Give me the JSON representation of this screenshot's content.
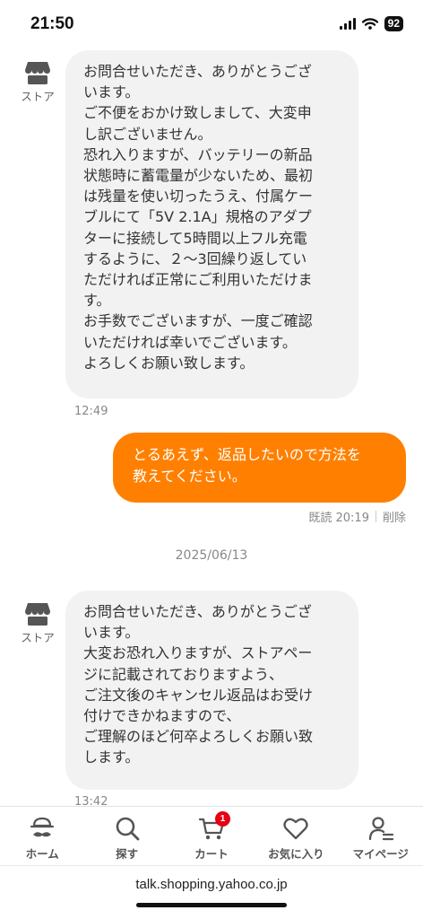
{
  "status": {
    "time": "21:50",
    "battery": "92"
  },
  "messages": [
    {
      "sender": "ストア",
      "text": "お問合せいただき、ありがとうござ\nいます。\nご不便をおかけ致しまして、大変申\nし訳ございません。\n恐れ入りますが、バッテリーの新品\n状態時に蓄電量が少ないため、最初\nは残量を使い切ったうえ、付属ケー\nブルにて「5V 2.1A」規格のアダプ\nターに接続して5時間以上フル充電\nするように、２〜3回繰り返してい\nただければ正常にご利用いただけま\nす。\nお手数でございますが、一度ご確認\nいただければ幸いでございます。\nよろしくお願い致します。",
      "time": "12:49"
    },
    {
      "sender": "me",
      "text": "とるあえず、返品したいので方法を\n教えてください。",
      "read_label": "既読 20:19",
      "delete_label": "削除"
    },
    {
      "sender": "ストア",
      "text": "お問合せいただき、ありがとうござ\nいます。\n大変お恐れ入りますが、ストアペー\nジに記載されておりますよう、\nご注文後のキャンセル返品はお受け\n付けできかねますので、\nご理解のほど何卒よろしくお願い致\nします。",
      "time": "13:42"
    }
  ],
  "date_divider": "2025/06/13",
  "tabs": [
    {
      "label": "ホーム",
      "icon": "home-mustache-icon"
    },
    {
      "label": "探す",
      "icon": "search-icon"
    },
    {
      "label": "カート",
      "icon": "cart-icon",
      "badge": "1"
    },
    {
      "label": "お気に入り",
      "icon": "heart-icon"
    },
    {
      "label": "マイページ",
      "icon": "profile-icon"
    }
  ],
  "url": "talk.shopping.yahoo.co.jp",
  "colors": {
    "accent": "#ff8000",
    "incoming_bubble": "#f2f2f2",
    "badge": "#e60012"
  }
}
